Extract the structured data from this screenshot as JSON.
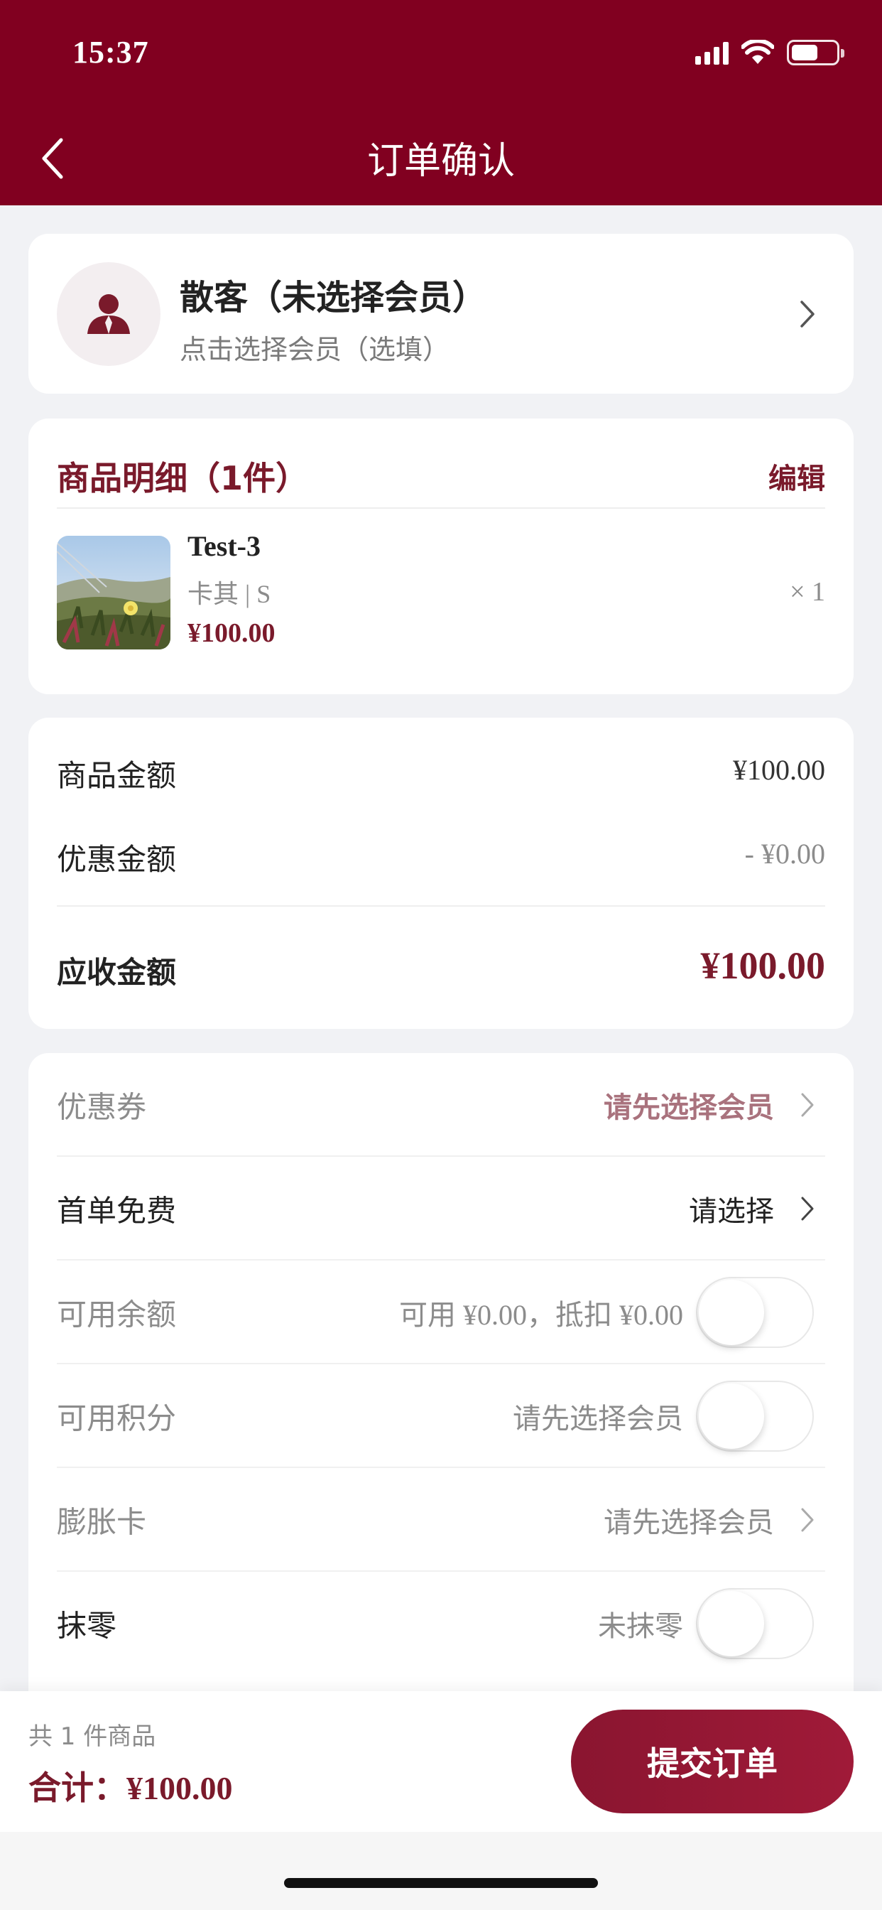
{
  "status_bar": {
    "time": "15:37"
  },
  "header": {
    "title": "订单确认"
  },
  "member": {
    "name": "散客（未选择会员）",
    "hint": "点击选择会员（选填）"
  },
  "goods": {
    "title": "商品明细（1件）",
    "edit_label": "编辑",
    "items": [
      {
        "name": "Test-3",
        "spec": "卡其 | S",
        "price": "¥100.00",
        "quantity": "× 1"
      }
    ]
  },
  "amounts": {
    "goods_amount_label": "商品金额",
    "goods_amount_value": "¥100.00",
    "discount_label": "优惠金额",
    "discount_value": "- ¥0.00",
    "receivable_label": "应收金额",
    "receivable_value": "¥100.00"
  },
  "options": [
    {
      "label": "优惠券",
      "value": "请先选择会员"
    },
    {
      "label": "首单免费",
      "value": "请选择"
    },
    {
      "label": "可用余额",
      "value": "可用 ¥0.00，抵扣 ¥0.00",
      "toggle_on": false
    },
    {
      "label": "可用积分",
      "value": "请先选择会员",
      "toggle_on": false
    },
    {
      "label": "膨胀卡",
      "value": "请先选择会员"
    },
    {
      "label": "抹零",
      "value": "未抹零",
      "toggle_on": false
    }
  ],
  "footer": {
    "item_count": "共 1 件商品",
    "total_label": "合计：",
    "total_value": "¥100.00",
    "submit_label": "提交订单"
  },
  "colors": {
    "brand": "#810020",
    "accent_text": "#7a1a2b"
  }
}
